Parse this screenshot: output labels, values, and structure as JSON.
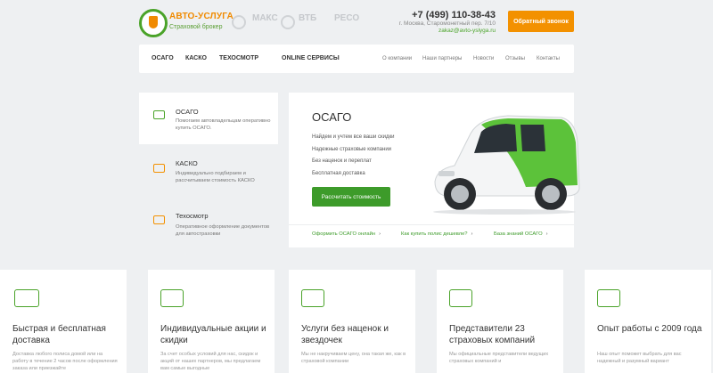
{
  "header": {
    "brand_name": "АВТО-УСЛУГА",
    "brand_sub": "Страховой брокер",
    "partners": [
      "МАКС",
      "ВТБ",
      "РЕСО"
    ],
    "phone": "+7 (499) 110-38-43",
    "address": "г. Москва, Старомонетный пер. 7/10",
    "email": "zakaz@avto-yslyga.ru",
    "callback_label": "Обратный звонок"
  },
  "nav": {
    "main": [
      "ОСАГО",
      "КАСКО",
      "ТЕХОСМОТР",
      "ONLINE СЕРВИСЫ"
    ],
    "secondary": [
      "О компании",
      "Наши партнеры",
      "Новости",
      "Отзывы",
      "Контакты"
    ]
  },
  "services": [
    {
      "title": "ОСАГО",
      "desc": "Помогаем автовладельцам оперативно купить ОСАГО."
    },
    {
      "title": "КАСКО",
      "desc": "Индивидуально подбираем и рассчитываем стоимость КАСКО"
    },
    {
      "title": "Техосмотр",
      "desc": "Оперативное оформление документов для автостраховки"
    }
  ],
  "hero": {
    "title": "ОСАГО",
    "features": [
      "Найдем и учтем все ваши скидки",
      "Надежные страховые компании",
      "Без наценок и переплат",
      "Бесплатная доставка"
    ],
    "button": "Рассчитать стоимость",
    "links": [
      "Оформить ОСАГО онлайн",
      "Как купить полис дешевле?",
      "База знаний ОСАГО"
    ],
    "chevron": "›"
  },
  "cards": [
    {
      "icon": "delivery-truck-icon",
      "title": "Быстрая и бесплатная доставка",
      "desc": "Доставка любого полиса домой или на работу в течение 2 часов после оформления заказа или приезжайте"
    },
    {
      "icon": "discount-tag-icon",
      "title": "Индивидуальные акции и скидки",
      "desc": "За счет особых условий для нас, скидок и акций от наших партнеров, мы предлагаем вам самые выгодные"
    },
    {
      "icon": "money-icon",
      "title": "Услуги без наценок и звездочек",
      "desc": "Мы не накручиваем цену, она такая же, как в страховой компании"
    },
    {
      "icon": "briefcase-icon",
      "title": "Представители 23 страховых компаний",
      "desc": "Мы официальные представители ведущих страховых компаний и"
    },
    {
      "icon": "certificate-icon",
      "title": "Опыт работы с 2009 года",
      "desc": "Наш опыт поможет выбрать для вас надежный и разумный вариант"
    }
  ],
  "colors": {
    "brand_green": "#4aa329",
    "brand_orange": "#f39100"
  }
}
